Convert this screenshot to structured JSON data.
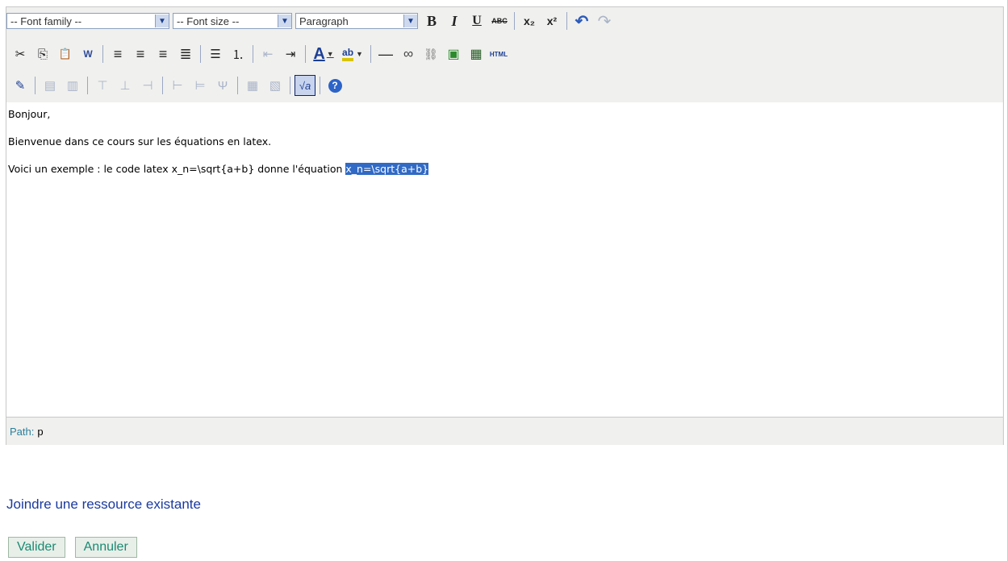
{
  "toolbar": {
    "font_family": "-- Font family --",
    "font_size": "-- Font size --",
    "format": "Paragraph",
    "row1": [
      {
        "name": "bold-button",
        "glyph": "B"
      },
      {
        "name": "italic-button",
        "glyph": "I"
      },
      {
        "name": "underline-button",
        "glyph": "U"
      },
      {
        "name": "strikethrough-button",
        "glyph": "ABC"
      },
      {
        "name": "subscript-button",
        "glyph": "x₂"
      },
      {
        "name": "superscript-button",
        "glyph": "x²"
      },
      {
        "name": "undo-button",
        "glyph": "↶"
      },
      {
        "name": "redo-button",
        "glyph": "↷"
      }
    ],
    "row2": [
      {
        "name": "cut-button",
        "glyph": "✂"
      },
      {
        "name": "copy-button",
        "glyph": "⎘"
      },
      {
        "name": "paste-button",
        "glyph": "📋"
      },
      {
        "name": "paste-word-button",
        "glyph": "W"
      },
      {
        "name": "align-left-button",
        "glyph": "≡"
      },
      {
        "name": "align-center-button",
        "glyph": "≡"
      },
      {
        "name": "align-right-button",
        "glyph": "≡"
      },
      {
        "name": "align-justify-button",
        "glyph": "≣"
      },
      {
        "name": "bullet-list-button",
        "glyph": "☰"
      },
      {
        "name": "numbered-list-button",
        "glyph": "⒈"
      },
      {
        "name": "outdent-button",
        "glyph": "⇤"
      },
      {
        "name": "indent-button",
        "glyph": "⇥"
      },
      {
        "name": "text-color-button",
        "glyph": "A"
      },
      {
        "name": "highlight-color-button",
        "glyph": "ab"
      },
      {
        "name": "horizontal-rule-button",
        "glyph": "—"
      },
      {
        "name": "insert-link-button",
        "glyph": "∞"
      },
      {
        "name": "unlink-button",
        "glyph": "⛓"
      },
      {
        "name": "insert-image-button",
        "glyph": "▣"
      },
      {
        "name": "insert-media-button",
        "glyph": "▦"
      },
      {
        "name": "html-source-button",
        "glyph": "HTML"
      }
    ],
    "row3": [
      {
        "name": "edit-css-button",
        "glyph": "✎"
      },
      {
        "name": "insert-table-button",
        "glyph": "▤"
      },
      {
        "name": "table-properties-button",
        "glyph": "▥"
      },
      {
        "name": "row-before-button",
        "glyph": "⊤"
      },
      {
        "name": "row-after-button",
        "glyph": "⊥"
      },
      {
        "name": "delete-row-button",
        "glyph": "⊣"
      },
      {
        "name": "col-before-button",
        "glyph": "⊢"
      },
      {
        "name": "col-after-button",
        "glyph": "⊨"
      },
      {
        "name": "delete-col-button",
        "glyph": "Ψ"
      },
      {
        "name": "merge-cells-button",
        "glyph": "▦"
      },
      {
        "name": "split-cells-button",
        "glyph": "▧"
      },
      {
        "name": "equation-button",
        "glyph": "√a"
      },
      {
        "name": "help-button",
        "glyph": "?"
      }
    ]
  },
  "content": {
    "line1": "Bonjour,",
    "line2": "Bienvenue dans ce cours sur les équations en latex.",
    "line3_prefix": "Voici un exemple : le code latex x_n=\\sqrt{a+b} donne l'équation ",
    "line3_selected": "x_n=\\sqrt{a+b}"
  },
  "status": {
    "path_label": "Path:",
    "path_value": "p"
  },
  "attach_link": "Joindre une ressource existante",
  "buttons": {
    "validate": "Valider",
    "cancel": "Annuler"
  }
}
